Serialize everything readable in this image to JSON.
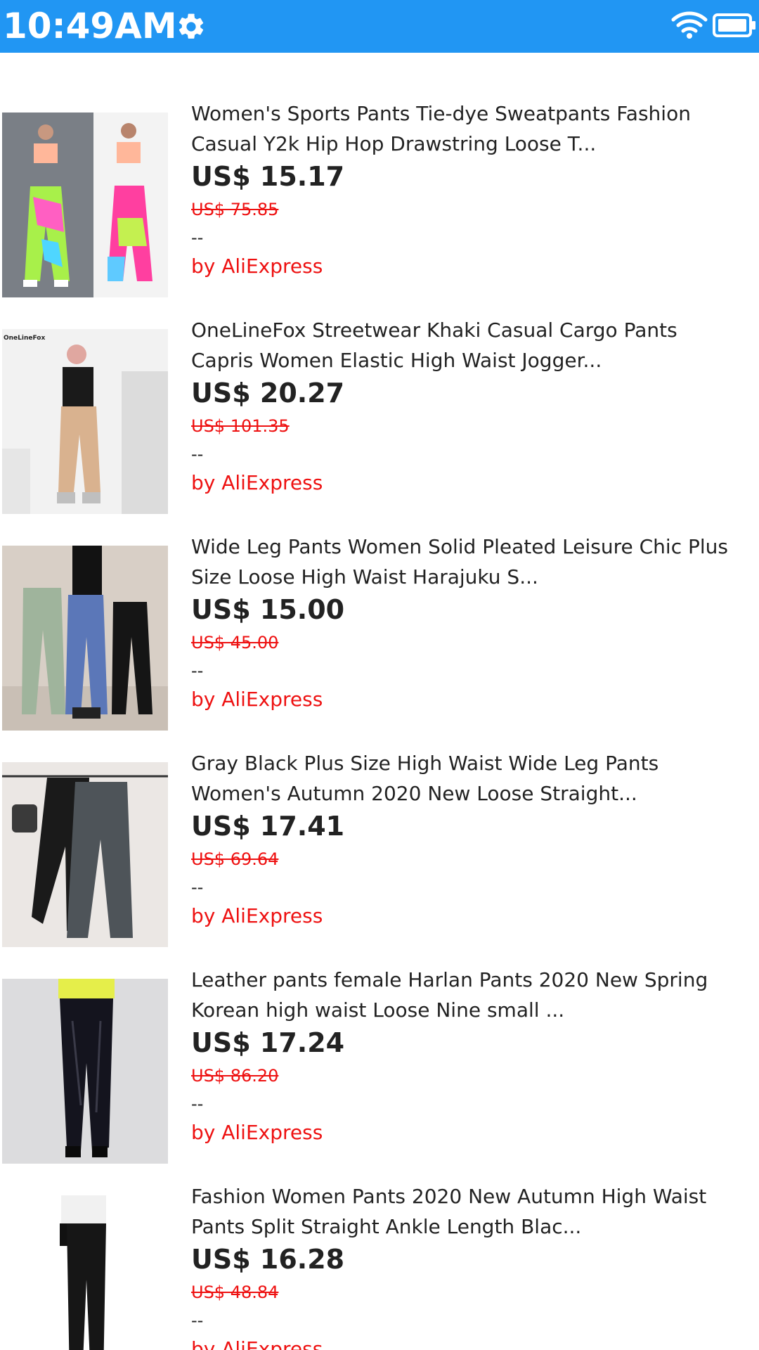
{
  "status_bar": {
    "time": "10:49AM",
    "color": "#2196F3",
    "icons": [
      "gear-icon",
      "wifi-icon",
      "battery-icon"
    ]
  },
  "products": [
    {
      "title_line1": "Women's Sports Pants Tie-dye Sweatpants Fashion",
      "title_line2": "Casual Y2k Hip Hop Drawstring Loose T...",
      "price": "US$ 15.17",
      "original_price": "US$ 75.85",
      "rating": "--",
      "seller": "by AliExpress"
    },
    {
      "title_line1": "OneLineFox Streetwear Khaki Casual Cargo Pants",
      "title_line2": "Capris Women Elastic High Waist Jogger...",
      "price": "US$ 20.27",
      "original_price": "US$ 101.35",
      "rating": "--",
      "seller": "by AliExpress",
      "image_text": "OneLineFox"
    },
    {
      "title_line1": "Wide Leg Pants Women Solid Pleated Leisure Chic Plus",
      "title_line2": "Size Loose High Waist Harajuku S...",
      "price": "US$ 15.00",
      "original_price": "US$ 45.00",
      "rating": "--",
      "seller": "by AliExpress"
    },
    {
      "title_line1": "Gray Black Plus Size High Waist Wide Leg Pants",
      "title_line2": "Women's Autumn 2020 New Loose Straight...",
      "price": "US$ 17.41",
      "original_price": "US$ 69.64",
      "rating": "--",
      "seller": "by AliExpress"
    },
    {
      "title_line1": "Leather pants female Harlan Pants 2020 New Spring",
      "title_line2": "Korean high waist Loose Nine small ...",
      "price": "US$ 17.24",
      "original_price": "US$ 86.20",
      "rating": "--",
      "seller": "by AliExpress"
    },
    {
      "title_line1": "Fashion Women Pants 2020 New Autumn High Waist",
      "title_line2": "Pants Split Straight Ankle Length Blac...",
      "price": "US$ 16.28",
      "original_price": "US$ 48.84",
      "rating": "--",
      "seller": "by AliExpress"
    }
  ]
}
